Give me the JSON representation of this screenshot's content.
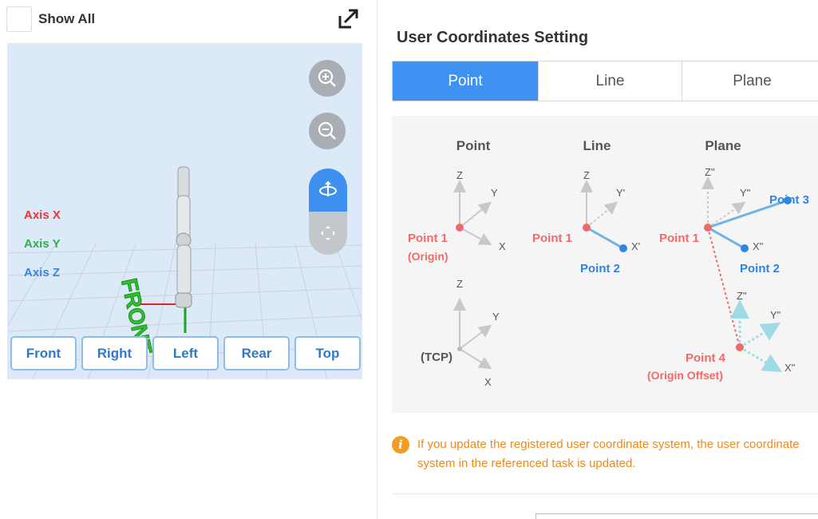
{
  "left_panel": {
    "show_all_label": "Show All",
    "axis_labels": {
      "x": "Axis X",
      "y": "Axis Y",
      "z": "Axis Z"
    },
    "floor_text": "FRONT",
    "view_buttons": [
      "Front",
      "Right",
      "Left",
      "Rear",
      "Top"
    ]
  },
  "right_panel": {
    "title": "User Coordinates Setting",
    "tabs": [
      {
        "label": "Point",
        "active": true
      },
      {
        "label": "Line",
        "active": false
      },
      {
        "label": "Plane",
        "active": false
      }
    ],
    "diagram": {
      "headers": {
        "point": "Point",
        "line": "Line",
        "plane": "Plane"
      },
      "axes": {
        "z": "Z",
        "y": "Y",
        "x": "X",
        "y_prime": "Y'",
        "x_prime": "X'",
        "z_dprime": "Z\"",
        "y_dprime": "Y\"",
        "x_dprime": "X\""
      },
      "labels": {
        "point1": "Point 1",
        "origin": "(Origin)",
        "point2": "Point 2",
        "point3": "Point 3",
        "point4": "Point 4",
        "origin_offset": "(Origin Offset)",
        "tcp": "(TCP)"
      }
    },
    "notice": "If you update the registered user coordinate system, the user coordinate system in the referenced task is updated."
  },
  "colors": {
    "accent": "#3d92f2",
    "axis_x": "#e83838",
    "axis_y": "#2fb04a",
    "axis_z": "#3d86d8",
    "notice": "#f08a16",
    "point_red": "#f06a6a",
    "point_blue": "#2f86e0",
    "arrow_gray": "#c8c8c8",
    "arrow_cyan": "#9fdbe6"
  },
  "icons": {
    "expand": "expand-arrow-icon",
    "zoom_in": "zoom-in-icon",
    "zoom_out": "zoom-out-icon",
    "rotate": "rotate-3d-icon",
    "pan": "pan-move-icon",
    "info": "info-icon"
  }
}
